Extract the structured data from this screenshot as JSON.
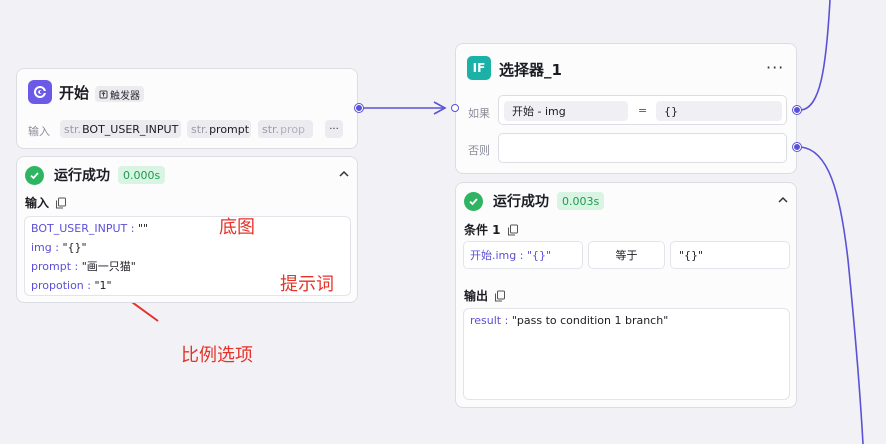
{
  "start_node": {
    "title": "开始",
    "trigger_badge": "触发器",
    "input_label": "输入",
    "params": [
      {
        "type": "str.",
        "name": "BOT_USER_INPUT"
      },
      {
        "type": "str.",
        "name": "prompt"
      },
      {
        "type": "str.",
        "name": "prop"
      }
    ],
    "more_label": "···"
  },
  "start_result": {
    "status": "运行成功",
    "time": "0.000s",
    "input_section": "输入",
    "entries": [
      {
        "key": "BOT_USER_INPUT",
        "value": "\"\""
      },
      {
        "key": "img",
        "value": "\"{}\""
      },
      {
        "key": "prompt",
        "value": "\"画一只猫\""
      },
      {
        "key": "propotion",
        "value": "\"1\""
      }
    ]
  },
  "annotations": {
    "base_image": "底图",
    "prompt_word": "提示词",
    "ratio_option": "比例选项"
  },
  "selector_node": {
    "title": "选择器_1",
    "more_label": "···",
    "if_icon_label": "IF",
    "if_label": "如果",
    "else_label": "否则",
    "condition_left": "开始  -  img",
    "condition_op": "=",
    "condition_right": "{}"
  },
  "selector_result": {
    "status": "运行成功",
    "time": "0.003s",
    "condition_section": "条件 1",
    "cond_left": "开始.img : \"{}\"",
    "cond_op": "等于",
    "cond_right": "\"{}\"",
    "output_section": "输出",
    "output_key": "result",
    "output_value": "\"pass to condition 1 branch\""
  },
  "colors": {
    "accent": "#5a52d6",
    "success": "#2fb562",
    "annotation": "#e5332a",
    "if_icon": "#1bb1a6"
  },
  "icons": {
    "start": "start-node-icon",
    "success": "check-circle-icon",
    "copy": "copy-icon",
    "collapse": "chevron-up-icon",
    "selector": "if-icon"
  }
}
